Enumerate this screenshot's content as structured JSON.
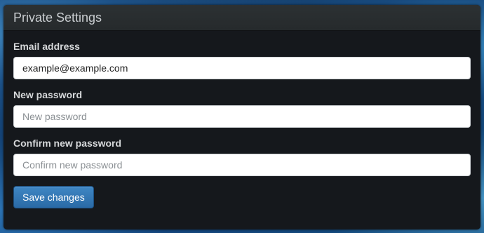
{
  "panel": {
    "title": "Private Settings"
  },
  "form": {
    "email": {
      "label": "Email address",
      "value": "example@example.com",
      "placeholder": ""
    },
    "new_password": {
      "label": "New password",
      "value": "",
      "placeholder": "New password"
    },
    "confirm_password": {
      "label": "Confirm new password",
      "value": "",
      "placeholder": "Confirm new password"
    },
    "save_label": "Save changes"
  },
  "colors": {
    "panel_background": "#15181c",
    "header_background": "#2c3133",
    "button_primary": "#3f86c4"
  }
}
